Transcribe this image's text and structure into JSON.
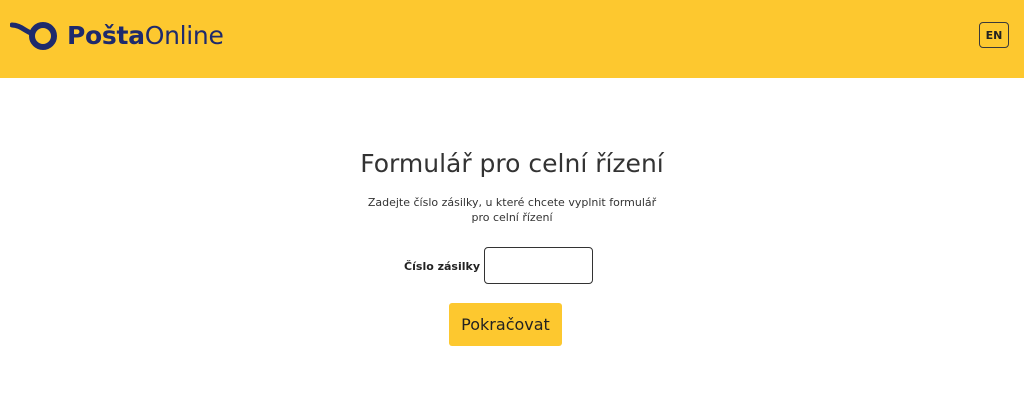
{
  "header": {
    "logo_bold": "Pošta",
    "logo_light": "Online",
    "language_button": "EN",
    "background_color": "#fdc82f",
    "brand_color": "#1e2a6c"
  },
  "form": {
    "title": "Formulář pro celní řízení",
    "subtitle_line1": "Zadejte číslo zásilky, u které chcete vyplnit formulář",
    "subtitle_line2": "pro celní řízení",
    "parcel_label": "Číslo zásilky",
    "parcel_value": "",
    "parcel_placeholder": "",
    "submit_label": "Pokračovat",
    "submit_color": "#fdc82f"
  }
}
